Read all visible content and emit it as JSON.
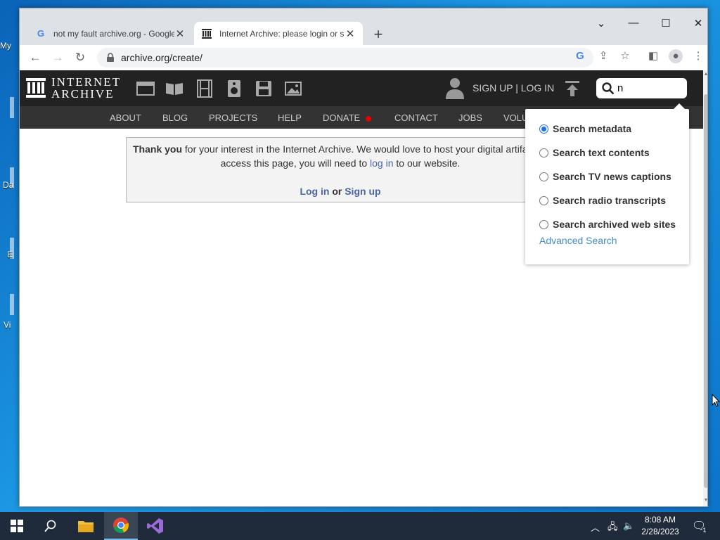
{
  "desktop": {
    "labels": [
      "My",
      "Da",
      "E",
      "Vi"
    ]
  },
  "browser": {
    "tabs": [
      {
        "title": "not my fault archive.org - Google",
        "active": false
      },
      {
        "title": "Internet Archive: please login or sign up",
        "active": true
      }
    ],
    "new_tab": "+",
    "url": "archive.org/create/"
  },
  "ia": {
    "logo_line1": "INTERNET",
    "logo_line2": "ARCHIVE",
    "auth": "SIGN UP | LOG IN",
    "search_value": "n",
    "subnav": [
      "ABOUT",
      "BLOG",
      "PROJECTS",
      "HELP",
      "DONATE",
      "CONTACT",
      "JOBS",
      "VOLU"
    ],
    "message": {
      "bold": "Thank you",
      "rest1": " for your interest in the Internet Archive. We would love to host your digital artifacts.",
      "line2_pre": "access this page, you will need to ",
      "line2_link": "log in",
      "line2_post": " to our website.",
      "login": "Log in",
      "or": " or ",
      "signup": "Sign up"
    },
    "search_options": [
      {
        "label": "Search metadata",
        "checked": true
      },
      {
        "label": "Search text contents",
        "checked": false
      },
      {
        "label": "Search TV news captions",
        "checked": false
      },
      {
        "label": "Search radio transcripts",
        "checked": false
      },
      {
        "label": "Search archived web sites",
        "checked": false
      }
    ],
    "advanced_search": "Advanced Search"
  },
  "taskbar": {
    "time": "8:08 AM",
    "date": "2/28/2023",
    "notifications": "1"
  }
}
